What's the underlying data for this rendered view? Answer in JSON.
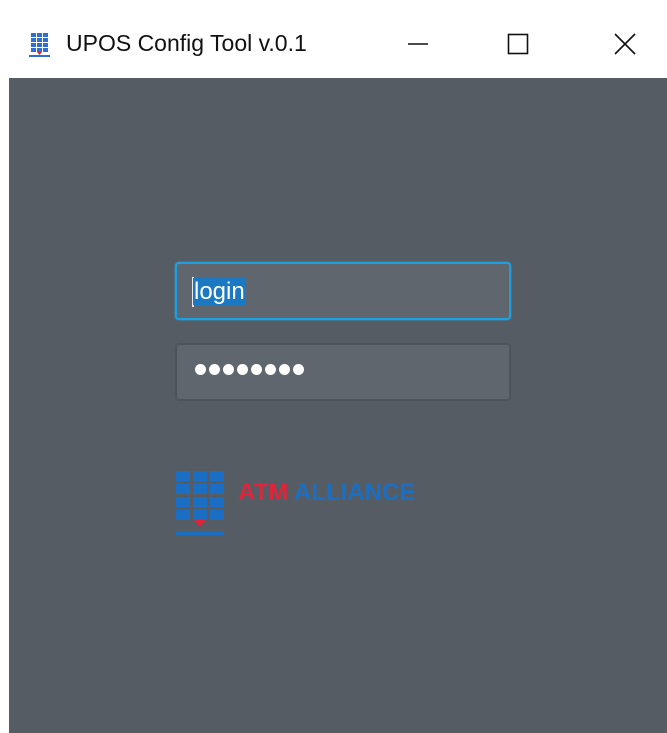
{
  "window": {
    "title": "UPOS Config Tool v.0.1",
    "controls": {
      "minimize_icon": "minimize-icon",
      "maximize_icon": "maximize-icon",
      "close_icon": "close-icon"
    }
  },
  "login_form": {
    "login_value": "login",
    "password_mask": "••••••••",
    "password_length": 8
  },
  "logo": {
    "word1": "ATM",
    "word2": "ALLIANCE",
    "color_primary": "#e2233a",
    "color_secondary": "#1a6fc4"
  },
  "colors": {
    "background": "#565c63",
    "field_focus_border": "#1ea0e0",
    "selection": "#1b78c2"
  }
}
